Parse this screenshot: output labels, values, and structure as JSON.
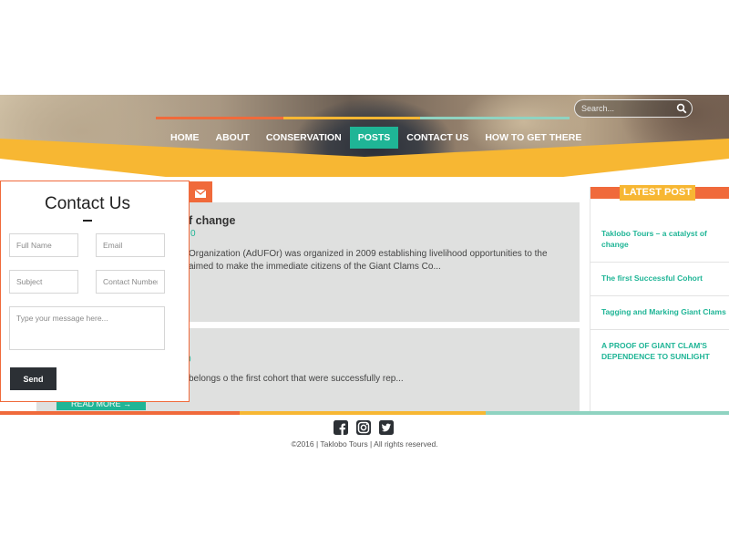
{
  "search": {
    "placeholder": "Search..."
  },
  "nav": {
    "items": [
      {
        "label": "HOME"
      },
      {
        "label": "ABOUT"
      },
      {
        "label": "CONSERVATION"
      },
      {
        "label": "POSTS",
        "active": true
      },
      {
        "label": "CONTACT US"
      },
      {
        "label": "HOW TO GET THERE"
      }
    ]
  },
  "posts": [
    {
      "title": "f change",
      "comments": "0",
      "excerpt": "Organization (AdUFOr) was organized in 2009 establishing livelihood opportunities to the aimed to make the immediate citizens of the Giant Clams Co..."
    },
    {
      "comments": "0",
      "excerpt": "belongs o the first cohort that were successfully rep...",
      "read_more": "READ MORE →"
    }
  ],
  "sidebar": {
    "heading": "LATEST POST",
    "links": [
      "Taklobo Tours – a catalyst of change",
      "The first Successful Cohort",
      "Tagging and Marking Giant Clams",
      "A PROOF OF GIANT CLAM'S DEPENDENCE TO SUNLIGHT"
    ]
  },
  "contact_form": {
    "title": "Contact Us",
    "full_name_placeholder": "Full Name",
    "email_placeholder": "Email",
    "subject_placeholder": "Subject",
    "contact_number_placeholder": "Contact Number",
    "message_placeholder": "Type your message here...",
    "send_label": "Send"
  },
  "footer": {
    "social_icons": [
      "facebook-icon",
      "instagram-icon",
      "twitter-icon"
    ],
    "copyright": "©2016 | Taklobo Tours | All rights reserved."
  },
  "colors": {
    "accent_teal": "#1fb596",
    "accent_orange": "#f06a3b",
    "accent_yellow": "#f7b733",
    "accent_mint": "#8fd3c1",
    "dark_button": "#2c3035",
    "post_background": "#dfe0df"
  }
}
